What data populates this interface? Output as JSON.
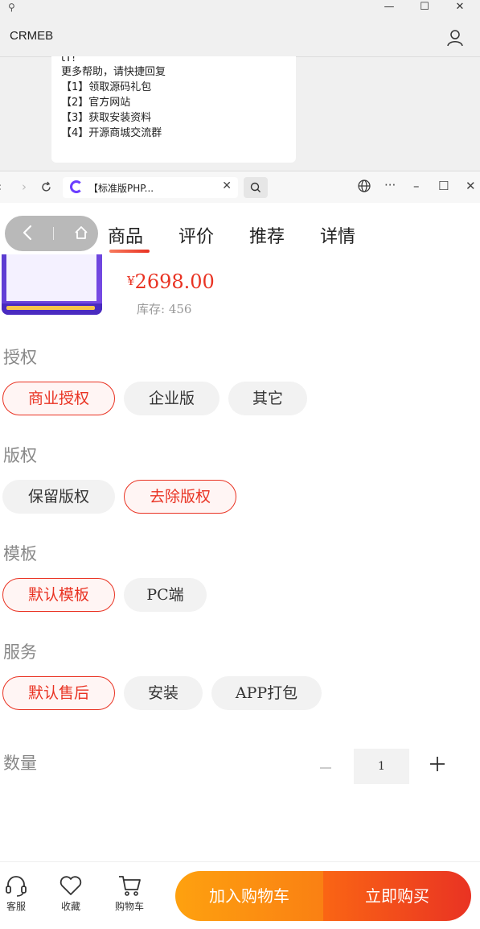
{
  "window": {
    "app_title": "CRMEB",
    "minimize": "—",
    "maximize": "☐",
    "close": "✕"
  },
  "chat": {
    "cut_line": "tT!",
    "lines": [
      "更多帮助，请快捷回复",
      "【1】领取源码礼包",
      "【2】官方网站",
      "【3】获取安装资料",
      "【4】开源商城交流群"
    ]
  },
  "browser": {
    "tab_title": "【标准版PHP...",
    "tab_close": "✕",
    "win_min": "–",
    "win_max": "☐",
    "win_close": "✕",
    "more": "···"
  },
  "product": {
    "currency": "¥",
    "price": "2698.00",
    "stock": "库存: 456"
  },
  "nav_tabs": [
    "商品",
    "评价",
    "推荐",
    "详情"
  ],
  "sections": [
    {
      "title": "授权",
      "options": [
        "商业授权",
        "企业版",
        "其它"
      ],
      "selected": 0
    },
    {
      "title": "版权",
      "options": [
        "保留版权",
        "去除版权"
      ],
      "selected": 1
    },
    {
      "title": "模板",
      "options": [
        "默认模板",
        "PC端"
      ],
      "selected": 0
    },
    {
      "title": "服务",
      "options": [
        "默认售后",
        "安装",
        "APP打包"
      ],
      "selected": 0
    }
  ],
  "quantity": {
    "label": "数量",
    "value": "1"
  },
  "footer": {
    "service": "客服",
    "favorite": "收藏",
    "cart": "购物车",
    "add_to_cart": "加入购物车",
    "buy_now": "立即购买"
  },
  "colors": {
    "accent": "#e93323",
    "orange": "#fea10f"
  }
}
